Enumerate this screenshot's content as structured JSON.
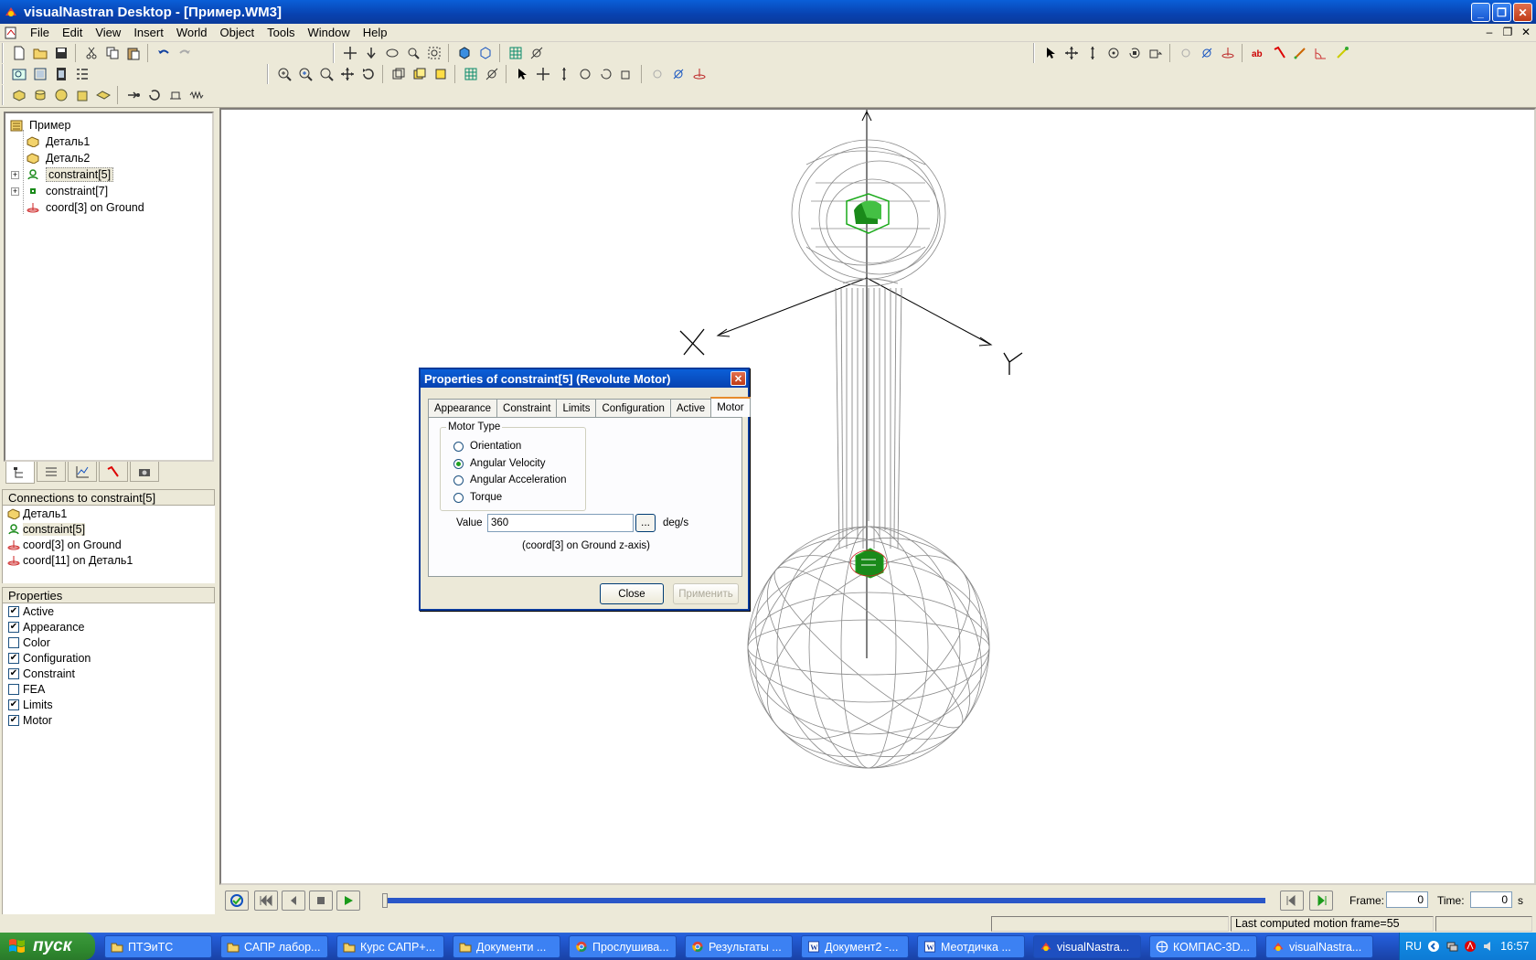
{
  "window": {
    "title": "visualNastran Desktop - [Пример.WM3]",
    "buttons": [
      "_",
      "❐",
      "✕"
    ]
  },
  "menu": {
    "items": [
      "File",
      "Edit",
      "View",
      "Insert",
      "World",
      "Object",
      "Tools",
      "Window",
      "Help"
    ],
    "mdi_buttons": [
      "–",
      "❐",
      "✕"
    ]
  },
  "tree": {
    "root": "Пример",
    "items": [
      {
        "label": "Деталь1",
        "icon": "part-icon"
      },
      {
        "label": "Деталь2",
        "icon": "part-icon"
      },
      {
        "label": "constraint[5]",
        "icon": "revolute-motor-icon",
        "expandable": true,
        "selected": true
      },
      {
        "label": "constraint[7]",
        "icon": "constraint-icon",
        "expandable": true
      },
      {
        "label": "coord[3] on Ground",
        "icon": "coord-icon"
      }
    ]
  },
  "connections": {
    "header": "Connections to constraint[5]",
    "items": [
      {
        "label": "Деталь1",
        "icon": "part-icon"
      },
      {
        "label": "constraint[5]",
        "icon": "revolute-motor-icon",
        "selected": true
      },
      {
        "label": "coord[3] on Ground",
        "icon": "coord-icon"
      },
      {
        "label": "coord[11] on Деталь1",
        "icon": "coord-icon"
      }
    ]
  },
  "properties": {
    "header": "Properties",
    "items": [
      {
        "label": "Active",
        "checked": true
      },
      {
        "label": "Appearance",
        "checked": true
      },
      {
        "label": "Color",
        "checked": false
      },
      {
        "label": "Configuration",
        "checked": true
      },
      {
        "label": "Constraint",
        "checked": true
      },
      {
        "label": "FEA",
        "checked": false
      },
      {
        "label": "Limits",
        "checked": true
      },
      {
        "label": "Motor",
        "checked": true
      }
    ]
  },
  "dialog": {
    "title": "Properties of constraint[5] (Revolute Motor)",
    "close_glyph": "✕",
    "tabs": [
      "Appearance",
      "Constraint",
      "Limits",
      "Configuration",
      "Active",
      "Motor"
    ],
    "active_tab": "Motor",
    "motor_type_label": "Motor Type",
    "motor_types": [
      "Orientation",
      "Angular Velocity",
      "Angular Acceleration",
      "Torque"
    ],
    "selected_motor_type": "Angular Velocity",
    "value_label": "Value",
    "value": "360",
    "dots_label": "...",
    "unit": "deg/s",
    "axis_note": "(coord[3] on Ground z-axis)",
    "close_button": "Close",
    "apply_button": "Применить"
  },
  "scene": {
    "axis_labels": [
      "X",
      "Y"
    ]
  },
  "playback": {
    "frame_label": "Frame:",
    "frame_value": "0",
    "time_label": "Time:",
    "time_value": "0",
    "time_unit": "s",
    "progress": 1.0
  },
  "status": {
    "message": "Last computed motion frame=55"
  },
  "taskbar": {
    "start_label": "пуск",
    "tasks": [
      {
        "label": "ПТЭиТС",
        "icon": "folder-icon"
      },
      {
        "label": "САПР лабор...",
        "icon": "folder-icon"
      },
      {
        "label": "Курс САПР+...",
        "icon": "folder-icon"
      },
      {
        "label": "Документи ...",
        "icon": "folder-icon"
      },
      {
        "label": "Прослушива...",
        "icon": "chrome-icon"
      },
      {
        "label": "Результаты ...",
        "icon": "chrome-icon"
      },
      {
        "label": "Документ2 -...",
        "icon": "word-icon"
      },
      {
        "label": "Меотдичка ...",
        "icon": "word-icon"
      },
      {
        "label": "visualNastra...",
        "icon": "vn-icon",
        "active": true
      },
      {
        "label": "КОМПАС-3D...",
        "icon": "kompas-icon"
      },
      {
        "label": "visualNastra...",
        "icon": "vn-icon"
      }
    ],
    "tray": {
      "lang": "RU",
      "clock": "16:57"
    }
  },
  "colors": {
    "selection_green": "#1a8a1a",
    "wireframe": "#8a8a8a",
    "title_blue": "#0842b0"
  }
}
